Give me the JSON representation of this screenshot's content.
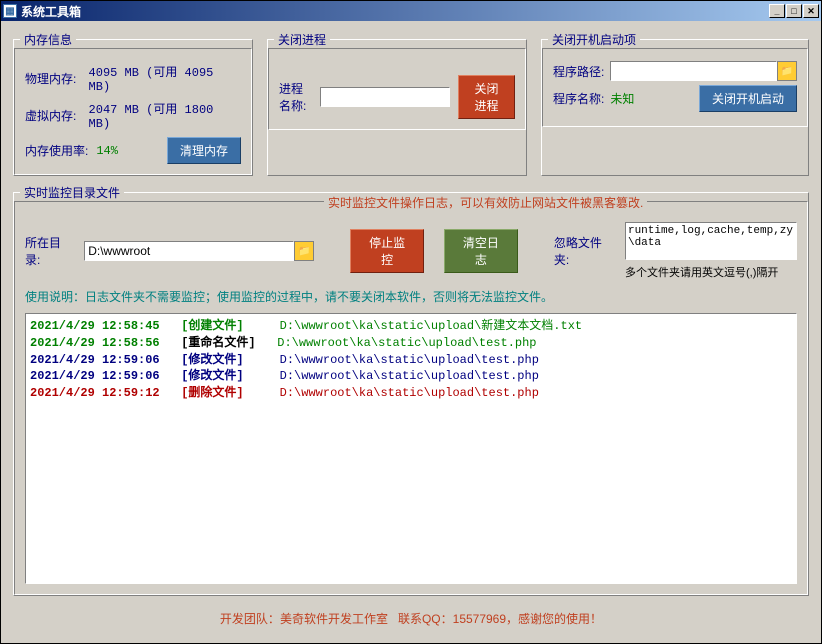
{
  "window": {
    "title": "系统工具箱"
  },
  "memory": {
    "legend": "内存信息",
    "physical_label": "物理内存:",
    "physical_value": "4095 MB (可用 4095 MB)",
    "virtual_label": "虚拟内存:",
    "virtual_value": "2047 MB (可用 1800 MB)",
    "usage_label": "内存使用率:",
    "usage_pct": "14%",
    "clean_btn": "清理内存"
  },
  "close_process": {
    "legend": "关闭进程",
    "name_label": "进程名称:",
    "name_value": "",
    "close_btn": "关闭进程"
  },
  "startup": {
    "legend": "关闭开机启动项",
    "path_label": "程序路径:",
    "path_value": "",
    "name_label": "程序名称:",
    "name_value": "未知",
    "close_btn": "关闭开机启动"
  },
  "monitor": {
    "legend": "实时监控目录文件",
    "title": "实时监控文件操作日志，可以有效防止网站文件被黑客篡改.",
    "dir_label": "所在目录:",
    "dir_value": "D:\\wwwroot",
    "stop_btn": "停止监控",
    "clear_btn": "清空日志",
    "ignore_label": "忽略文件夹:",
    "ignore_value": "runtime,log,cache,temp,zy\\data",
    "ignore_hint": "多个文件夹请用英文逗号(,)隔开",
    "usage_desc": "使用说明：日志文件夹不需要监控；使用监控的过程中，请不要关闭本软件，否则将无法监控文件。"
  },
  "log": [
    {
      "ts": "2021/4/29 12:58:45",
      "ts_cls": "ts-green",
      "tag": "[创建文件]",
      "tag_cls": "tag-green",
      "path": "D:\\wwwroot\\ka\\static\\upload\\新建文本文档.txt",
      "path_cls": "path-green"
    },
    {
      "ts": "2021/4/29 12:58:56",
      "ts_cls": "ts-green",
      "tag": "[重命名文件]",
      "tag_cls": "tag-black",
      "path": "D:\\wwwroot\\ka\\static\\upload\\test.php",
      "path_cls": "path-green"
    },
    {
      "ts": "2021/4/29 12:59:06",
      "ts_cls": "ts-blue",
      "tag": "[修改文件]",
      "tag_cls": "tag-blue",
      "path": "D:\\wwwroot\\ka\\static\\upload\\test.php",
      "path_cls": "path-blue"
    },
    {
      "ts": "2021/4/29 12:59:06",
      "ts_cls": "ts-blue",
      "tag": "[修改文件]",
      "tag_cls": "tag-blue",
      "path": "D:\\wwwroot\\ka\\static\\upload\\test.php",
      "path_cls": "path-blue"
    },
    {
      "ts": "2021/4/29 12:59:12",
      "ts_cls": "ts-red",
      "tag": "[删除文件]",
      "tag_cls": "tag-red",
      "path": "D:\\wwwroot\\ka\\static\\upload\\test.php",
      "path_cls": "path-red"
    }
  ],
  "footer": {
    "team_label": "开发团队：",
    "team_name": "美奇软件开发工作室",
    "qq_label": "联系QQ：",
    "qq_value": "15577969，",
    "thanks": "感谢您的使用！"
  }
}
